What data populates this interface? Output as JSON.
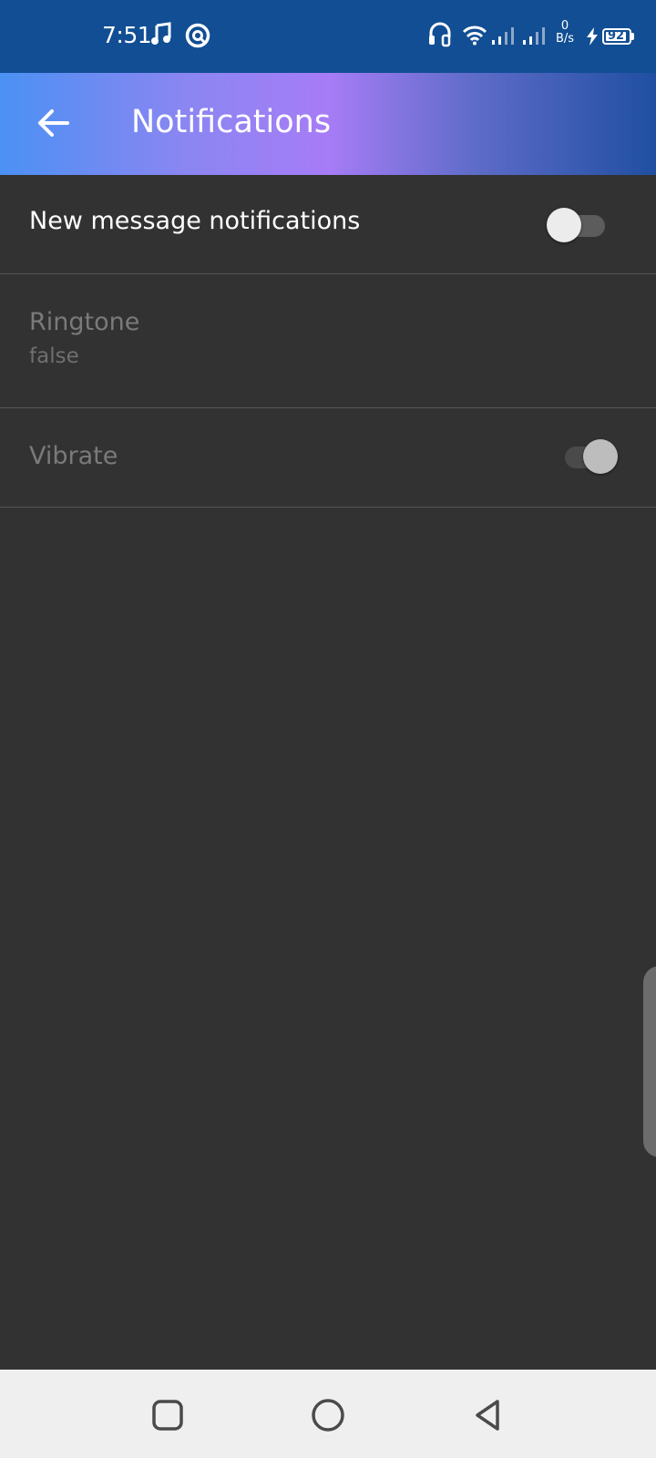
{
  "status_bar": {
    "time": "7:51",
    "net_speed_value": "0",
    "net_speed_unit": "B/s",
    "battery": "92",
    "icons": [
      "music-note-icon",
      "at-circle-icon",
      "headset-icon",
      "wifi-icon",
      "signal-icon",
      "signal-icon",
      "charging-bolt-icon",
      "battery-icon"
    ]
  },
  "toolbar": {
    "title": "Notifications",
    "back_icon": "arrow-left-icon"
  },
  "preferences": [
    {
      "title": "New message notifications",
      "type": "switch",
      "checked": false,
      "enabled": true
    },
    {
      "title": "Ringtone",
      "summary": "false",
      "type": "list",
      "enabled": false
    },
    {
      "title": "Vibrate",
      "type": "switch",
      "checked": true,
      "enabled": false
    }
  ],
  "nav_bar": {
    "buttons": [
      "recents-square-icon",
      "home-circle-icon",
      "back-triangle-icon"
    ]
  },
  "colors": {
    "status_bar": "#114e94",
    "background": "#323232",
    "nav_bar": "#efefef"
  }
}
